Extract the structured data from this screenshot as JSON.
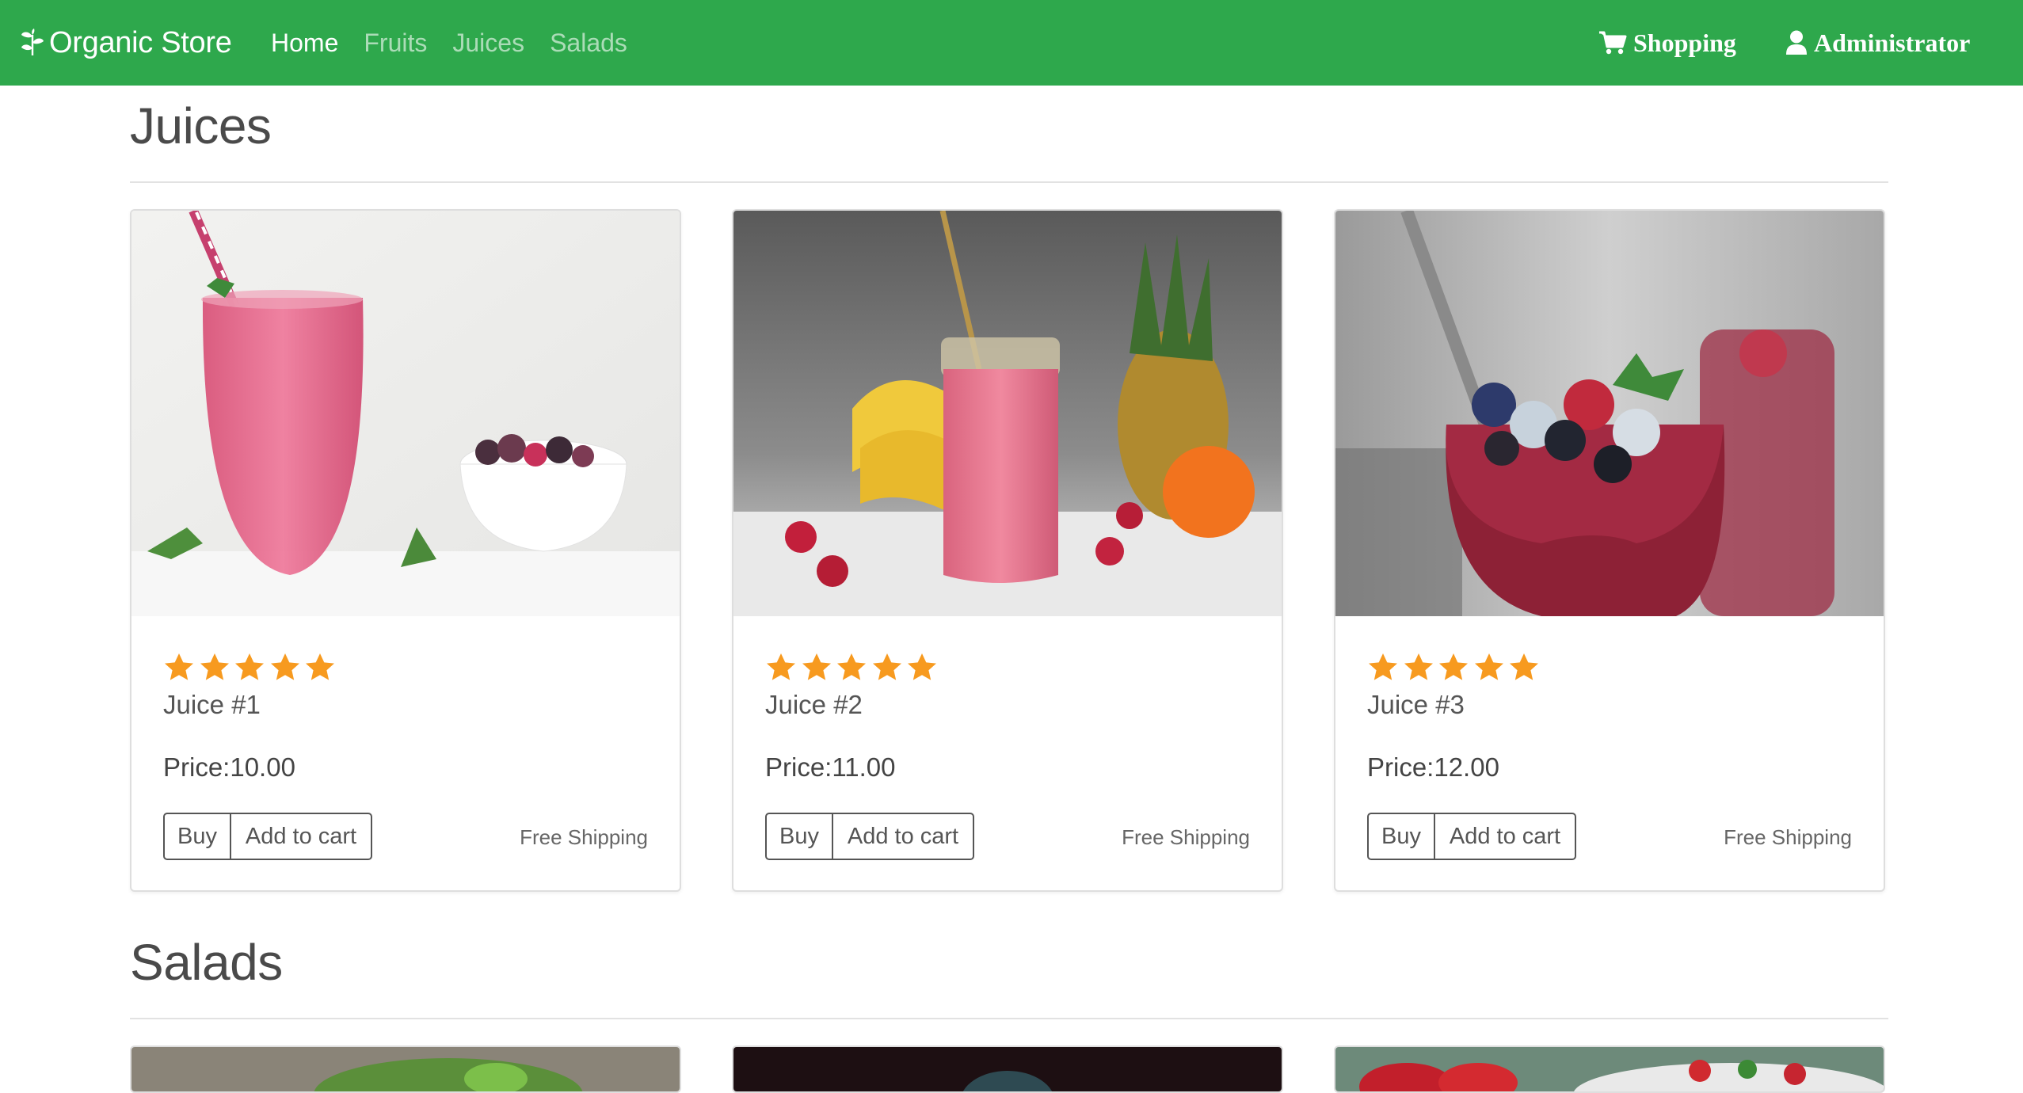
{
  "navbar": {
    "brand": "Organic Store",
    "links": [
      "Home",
      "Fruits",
      "Juices",
      "Salads"
    ],
    "active_index": 0,
    "shopping": "Shopping",
    "admin": "Administrator"
  },
  "sections": [
    {
      "title": "Juices"
    },
    {
      "title": "Salads"
    }
  ],
  "products": [
    {
      "name": "Juice #1",
      "price": "Price:10.00",
      "rating": 5,
      "buy": "Buy",
      "add_to_cart": "Add to cart",
      "shipping": "Free Shipping"
    },
    {
      "name": "Juice #2",
      "price": "Price:11.00",
      "rating": 5,
      "buy": "Buy",
      "add_to_cart": "Add to cart",
      "shipping": "Free Shipping"
    },
    {
      "name": "Juice #3",
      "price": "Price:12.00",
      "rating": 5,
      "buy": "Buy",
      "add_to_cart": "Add to cart",
      "shipping": "Free Shipping"
    }
  ],
  "colors": {
    "navbar": "#2ea84c",
    "star": "#f79a1f"
  },
  "icons": [
    "leaf-icon",
    "cart-icon",
    "user-icon",
    "star-icon"
  ]
}
